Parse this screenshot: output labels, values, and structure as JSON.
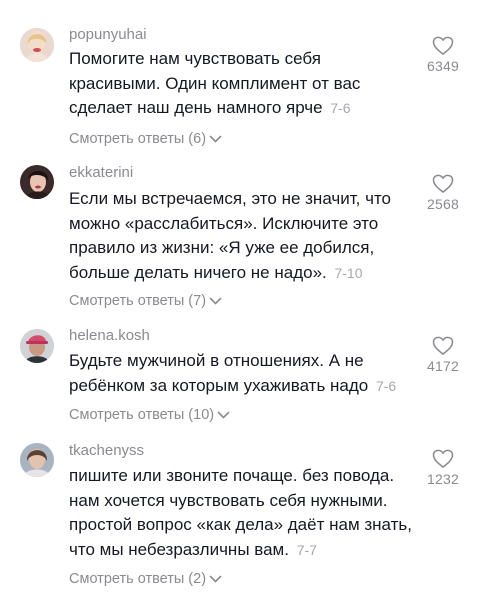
{
  "comments": [
    {
      "username": "popunyuhai",
      "text_lines": [
        "Помогите нам чувствовать себя",
        "красивыми. Один комплимент от вас",
        "сделает наш день намного ярче"
      ],
      "date": "7-6",
      "replies_label": "Смотреть ответы (6)",
      "likes": "6349"
    },
    {
      "username": "ekkaterini",
      "text_lines": [
        "Если мы встречаемся, это не значит, что",
        "можно «расслабиться». Исключите это",
        "правило из жизни: «Я уже ее добился,",
        "больше делать ничего не надо»."
      ],
      "date": "7-10",
      "replies_label": "Смотреть ответы (7)",
      "likes": "2568"
    },
    {
      "username": "helena.kosh",
      "text_lines": [
        "Будьте мужчиной в отношениях. А не",
        "ребёнком за которым ухаживать надо"
      ],
      "date": "7-6",
      "replies_label": "Смотреть ответы (10)",
      "likes": "4172"
    },
    {
      "username": "tkachenyss",
      "text_lines": [
        "пишите или звоните почаще. без повода.",
        "нам хочется чувствовать себя нужными.",
        "простой вопрос «как дела» даёт нам знать,",
        "что мы небезразличны вам."
      ],
      "date": "7-7",
      "replies_label": "Смотреть ответы (2)",
      "likes": "1232"
    }
  ],
  "icons": {
    "like": "heart-outline-icon",
    "expand": "chevron-down-icon"
  },
  "colors": {
    "text": "#161823",
    "secondary": "#8a8b91",
    "date": "#a7a8ad"
  }
}
